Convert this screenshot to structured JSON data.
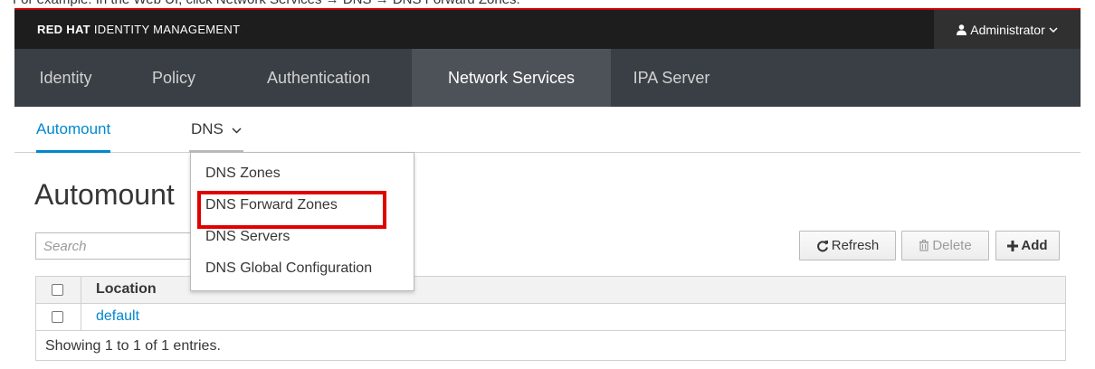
{
  "caption_text": "For example: In the Web UI, click Network Services → DNS → DNS Forward Zones.",
  "header": {
    "brand_bold": "RED HAT",
    "brand_rest": "IDENTITY MANAGEMENT",
    "user_label": "Administrator"
  },
  "nav": {
    "tabs": [
      "Identity",
      "Policy",
      "Authentication",
      "Network Services",
      "IPA Server"
    ],
    "active": "Network Services"
  },
  "subnav": {
    "automount": "Automount",
    "dns": "DNS"
  },
  "page": {
    "title": "Automount"
  },
  "search": {
    "placeholder": "Search"
  },
  "toolbar": {
    "refresh": "Refresh",
    "delete": "Delete",
    "add": "Add"
  },
  "table": {
    "header": "Location",
    "rows": [
      "default"
    ],
    "footer": "Showing 1 to 1 of 1 entries."
  },
  "dns_menu": {
    "items": [
      "DNS Zones",
      "DNS Forward Zones",
      "DNS Servers",
      "DNS Global Configuration"
    ],
    "highlighted": "DNS Forward Zones"
  },
  "colors": {
    "accent": "#0088ce",
    "highlight": "#e00000",
    "topbar": "#1d1d1d",
    "navbar": "#393f44"
  }
}
